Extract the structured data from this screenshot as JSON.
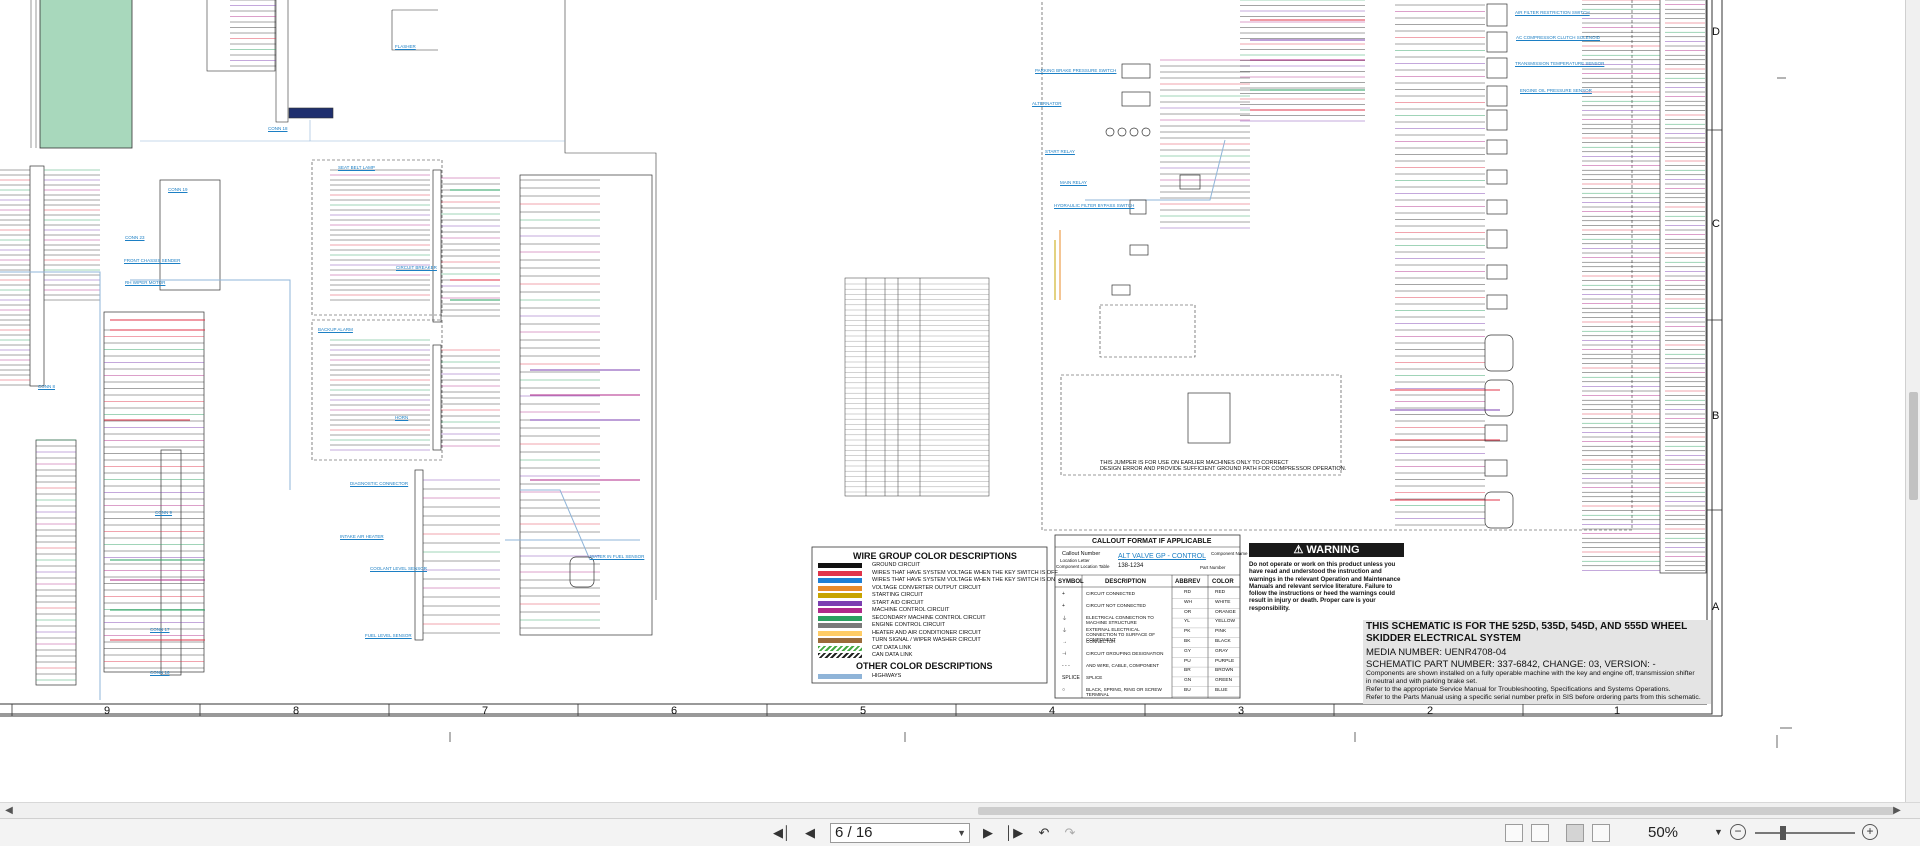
{
  "document": {
    "page_indicator": "6 / 16",
    "zoom_level": "50%"
  },
  "legend": {
    "title": "WIRE GROUP COLOR DESCRIPTIONS",
    "rows": [
      {
        "color": "#111111",
        "label": "GROUND CIRCUIT"
      },
      {
        "color": "#e0344a",
        "label": "WIRES THAT HAVE SYSTEM VOLTAGE WHEN THE KEY SWITCH IS OFF"
      },
      {
        "color": "#1e7fd4",
        "label": "WIRES THAT HAVE SYSTEM VOLTAGE WHEN THE KEY SWITCH IS ON"
      },
      {
        "color": "#e88b2a",
        "label": "VOLTAGE CONVERTER OUTPUT CIRCUIT"
      },
      {
        "color": "#c7a400",
        "label": "STARTING CIRCUIT"
      },
      {
        "color": "#7b3fb0",
        "label": "START AID CIRCUIT"
      },
      {
        "color": "#b02a8a",
        "label": "MACHINE CONTROL CIRCUIT"
      },
      {
        "color": "#2aa060",
        "label": "SECONDARY MACHINE CONTROL CIRCUIT"
      },
      {
        "color": "#7a7a7a",
        "label": "ENGINE CONTROL CIRCUIT"
      },
      {
        "color": "#ffcc66",
        "label": "HEATER AND AIR CONDITIONER CIRCUIT"
      },
      {
        "color": "#9b6b3a",
        "label": "TURN SIGNAL / WIPER WASHER CIRCUIT"
      },
      {
        "color": "#44aa44",
        "label": "CAT DATA LINK"
      },
      {
        "color": "#222222",
        "label": "CAN DATA LINK"
      }
    ],
    "other_title": "OTHER COLOR DESCRIPTIONS",
    "other_rows": [
      {
        "color": "#8fb4d8",
        "label": "HIGHWAYS"
      }
    ]
  },
  "callout": {
    "title": "CALLOUT FORMAT IF APPLICABLE",
    "example_name": "ALT VALVE GP - CONTROL",
    "example_number": "138-1234",
    "left_labels": [
      "Callout Number",
      "Location Letter",
      "Component Location Table"
    ],
    "right_labels": [
      "Component Name",
      "Part Number"
    ]
  },
  "symbol_table": {
    "headers": [
      "SYMBOL",
      "DESCRIPTION"
    ],
    "rows": [
      {
        "symbol": "+",
        "desc": "CIRCUIT CONNECTED"
      },
      {
        "symbol": "+",
        "desc": "CIRCUIT NOT CONNECTED"
      },
      {
        "symbol": "⏚",
        "desc": "ELECTRICAL CONNECTION TO MACHINE STRUCTURE"
      },
      {
        "symbol": "⏚",
        "desc": "EXTERNAL ELECTRICAL CONNECTION TO SURFACE OF COMPONENT"
      },
      {
        "symbol": "→",
        "desc": "CONNECTOR"
      },
      {
        "symbol": "⊣",
        "desc": "CIRCUIT GROUPING DESIGNATION"
      },
      {
        "symbol": "- - -",
        "desc": "AND WIRE, CABLE, COMPONENT"
      },
      {
        "symbol": "SPLICE",
        "desc": "SPLICE"
      },
      {
        "symbol": "○",
        "desc": "BLACK, SPRING, RING OR SCREW TERMINAL"
      }
    ]
  },
  "color_abbrev": {
    "headers": [
      "ABBREV",
      "COLOR"
    ],
    "rows": [
      [
        "RD",
        "RED"
      ],
      [
        "WH",
        "WHITE"
      ],
      [
        "OR",
        "ORANGE"
      ],
      [
        "YL",
        "YELLOW"
      ],
      [
        "PK",
        "PINK"
      ],
      [
        "BK",
        "BLACK"
      ],
      [
        "GY",
        "GRAY"
      ],
      [
        "PU",
        "PURPLE"
      ],
      [
        "BR",
        "BROWN"
      ],
      [
        "GN",
        "GREEN"
      ],
      [
        "BU",
        "BLUE"
      ]
    ]
  },
  "warning": {
    "heading": "WARNING",
    "text": "Do not operate or work on this product unless you have read and understood the instruction and warnings in the relevant Operation and Maintenance Manuals and relevant service literature. Failure to follow the instructions or heed the warnings could result in injury or death. Proper care is your responsibility."
  },
  "jumper_note": {
    "line1": "THIS JUMPER IS FOR USE ON EARLIER MACHINES ONLY TO CORRECT",
    "line2": "DESIGN ERROR AND PROVIDE SUFFICIENT GROUND PATH FOR COMPRESSOR OPERATION."
  },
  "title_block": {
    "title": "THIS SCHEMATIC IS FOR THE 525D, 535D, 545D, AND 555D WHEEL SKIDDER ELECTRICAL SYSTEM",
    "media_number": "MEDIA NUMBER: UENR4708-04",
    "part_number": "SCHEMATIC PART NUMBER: 337-6842, CHANGE: 03, VERSION: -",
    "notes": [
      "Components are shown installed on a fully operable machine with the key and engine off, transmission shifter",
      "in neutral and with parking brake set.",
      "Refer to the appropriate Service Manual for Troubleshooting, Specifications and Systems Operations.",
      "Refer to the Parts Manual using a specific serial number prefix in SIS before ordering parts from this schematic."
    ]
  },
  "grid": {
    "columns": [
      "9",
      "8",
      "7",
      "6",
      "5",
      "4",
      "3",
      "2",
      "1"
    ],
    "rows": [
      "D",
      "C",
      "B",
      "A"
    ]
  },
  "component_labels": [
    "CONN 8",
    "CONN 9",
    "CONN 16",
    "CONN 17",
    "CONN 18",
    "CONN 19",
    "CONN 23",
    "FRONT CHASSIS SENDER",
    "RH WIPER MOTOR",
    "FLASHER",
    "SEAT BELT LAMP",
    "CIRCUIT BREAKER",
    "BACKUP ALARM",
    "HORN",
    "DIAGNOSTIC CONNECTOR",
    "INTAKE AIR HEATER",
    "COOLANT LEVEL SENSOR",
    "FUEL LEVEL SENSOR",
    "WATER IN FUEL SENSOR",
    "PARKING BRAKE PRESSURE SWITCH",
    "ALTERNATOR",
    "START RELAY",
    "MAIN RELAY",
    "HYDRAULIC FILTER BYPASS SWITCH",
    "AIR FILTER RESTRICTION SWITCH",
    "AC COMPRESSOR CLUTCH SOLENOID",
    "TRANSMISSION TEMPERATURE SENSOR",
    "ENGINE OIL PRESSURE SENSOR"
  ]
}
